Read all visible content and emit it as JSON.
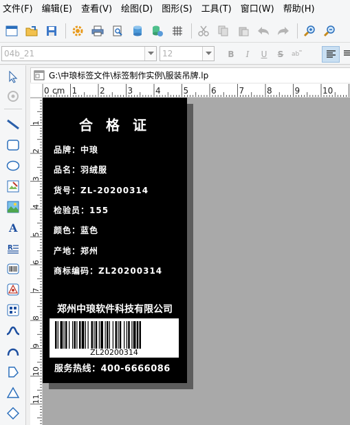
{
  "menu": {
    "items": [
      "文件(F)",
      "编辑(E)",
      "查看(V)",
      "绘图(D)",
      "图形(S)",
      "工具(T)",
      "窗口(W)",
      "帮助(H)"
    ]
  },
  "toolbar": {
    "icons": [
      "new-window-icon",
      "open-folder-icon",
      "save-icon",
      "settings-icon",
      "print-icon",
      "print-preview-icon",
      "database-icon",
      "database-settings-icon",
      "grid-icon",
      "cut-icon",
      "copy-icon",
      "paste-icon",
      "undo-icon",
      "redo-icon",
      "zoom-in-icon",
      "zoom-out-icon"
    ]
  },
  "format_bar": {
    "font_name": "04b_21",
    "font_size": "12",
    "bold": "B",
    "italic": "I",
    "underline": "U",
    "strike": "S"
  },
  "document": {
    "path": "G:\\中琅标签文件\\标签制作实例\\服装吊牌.lp"
  },
  "ruler": {
    "unit": "cm",
    "marks": [
      "0",
      "1",
      "2",
      "3",
      "4",
      "5",
      "6",
      "7",
      "8",
      "9",
      "10"
    ]
  },
  "label": {
    "title": "合 格 证",
    "rows": [
      "品牌：中琅",
      "品名：羽绒服",
      "货号：ZL-20200314",
      "检验员：155",
      "颜色：蓝色",
      "产地：郑州",
      "商标编码：ZL20200314"
    ],
    "company": "郑州中琅软件科技有限公司",
    "barcode_value": "ZL20200314",
    "hotline": "服务热线：400-6666086"
  },
  "colors": {
    "label_bg": "#000000",
    "canvas_bg": "#a9a9a9",
    "highlight": "#c9dff2"
  }
}
